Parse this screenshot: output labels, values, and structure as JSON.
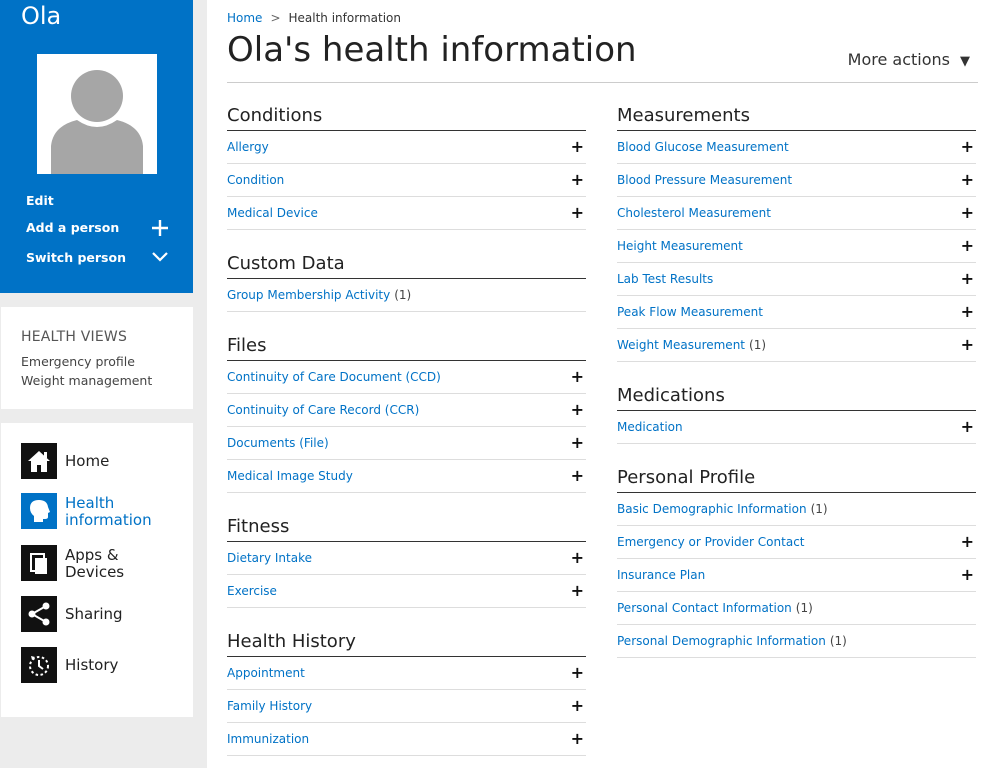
{
  "profile": {
    "name": "Ola",
    "edit_label": "Edit",
    "add_person_label": "Add a person",
    "switch_person_label": "Switch person"
  },
  "health_views": {
    "header": "HEALTH VIEWS",
    "items": [
      "Emergency profile",
      "Weight management"
    ]
  },
  "nav": {
    "items": [
      {
        "label": "Home",
        "icon": "home-icon"
      },
      {
        "label": "Health information",
        "icon": "head-profile-icon",
        "active": true
      },
      {
        "label": "Apps & Devices",
        "icon": "devices-icon"
      },
      {
        "label": "Sharing",
        "icon": "share-icon"
      },
      {
        "label": "History",
        "icon": "history-icon"
      }
    ]
  },
  "breadcrumb": {
    "home": "Home",
    "separator": ">",
    "current": "Health information"
  },
  "page_title": "Ola's health information",
  "more_actions_label": "More actions",
  "colors": {
    "accent": "#0072c6",
    "sidebar_bg": "#0072c6",
    "page_bg": "#ececec"
  },
  "left_sections": [
    {
      "title": "Conditions",
      "items": [
        {
          "label": "Allergy",
          "count": "",
          "plus": true
        },
        {
          "label": "Condition",
          "count": "",
          "plus": true
        },
        {
          "label": "Medical Device",
          "count": "",
          "plus": true
        }
      ]
    },
    {
      "title": "Custom Data",
      "items": [
        {
          "label": "Group Membership Activity",
          "count": "(1)",
          "plus": false
        }
      ]
    },
    {
      "title": "Files",
      "items": [
        {
          "label": "Continuity of Care Document (CCD)",
          "count": "",
          "plus": true
        },
        {
          "label": "Continuity of Care Record (CCR)",
          "count": "",
          "plus": true
        },
        {
          "label": "Documents (File)",
          "count": "",
          "plus": true
        },
        {
          "label": "Medical Image Study",
          "count": "",
          "plus": true
        }
      ]
    },
    {
      "title": "Fitness",
      "items": [
        {
          "label": "Dietary Intake",
          "count": "",
          "plus": true
        },
        {
          "label": "Exercise",
          "count": "",
          "plus": true
        }
      ]
    },
    {
      "title": "Health History",
      "items": [
        {
          "label": "Appointment",
          "count": "",
          "plus": true
        },
        {
          "label": "Family History",
          "count": "",
          "plus": true
        },
        {
          "label": "Immunization",
          "count": "",
          "plus": true
        }
      ]
    }
  ],
  "right_sections": [
    {
      "title": "Measurements",
      "items": [
        {
          "label": "Blood Glucose Measurement",
          "count": "",
          "plus": true
        },
        {
          "label": "Blood Pressure Measurement",
          "count": "",
          "plus": true
        },
        {
          "label": "Cholesterol Measurement",
          "count": "",
          "plus": true
        },
        {
          "label": "Height Measurement",
          "count": "",
          "plus": true
        },
        {
          "label": "Lab Test Results",
          "count": "",
          "plus": true
        },
        {
          "label": "Peak Flow Measurement",
          "count": "",
          "plus": true
        },
        {
          "label": "Weight Measurement",
          "count": "(1)",
          "plus": true
        }
      ]
    },
    {
      "title": "Medications",
      "items": [
        {
          "label": "Medication",
          "count": "",
          "plus": true
        }
      ]
    },
    {
      "title": "Personal Profile",
      "items": [
        {
          "label": "Basic Demographic Information",
          "count": "(1)",
          "plus": false
        },
        {
          "label": "Emergency or Provider Contact",
          "count": "",
          "plus": true
        },
        {
          "label": "Insurance Plan",
          "count": "",
          "plus": true
        },
        {
          "label": "Personal Contact Information",
          "count": "(1)",
          "plus": false
        },
        {
          "label": "Personal Demographic Information",
          "count": "(1)",
          "plus": false
        }
      ]
    }
  ]
}
